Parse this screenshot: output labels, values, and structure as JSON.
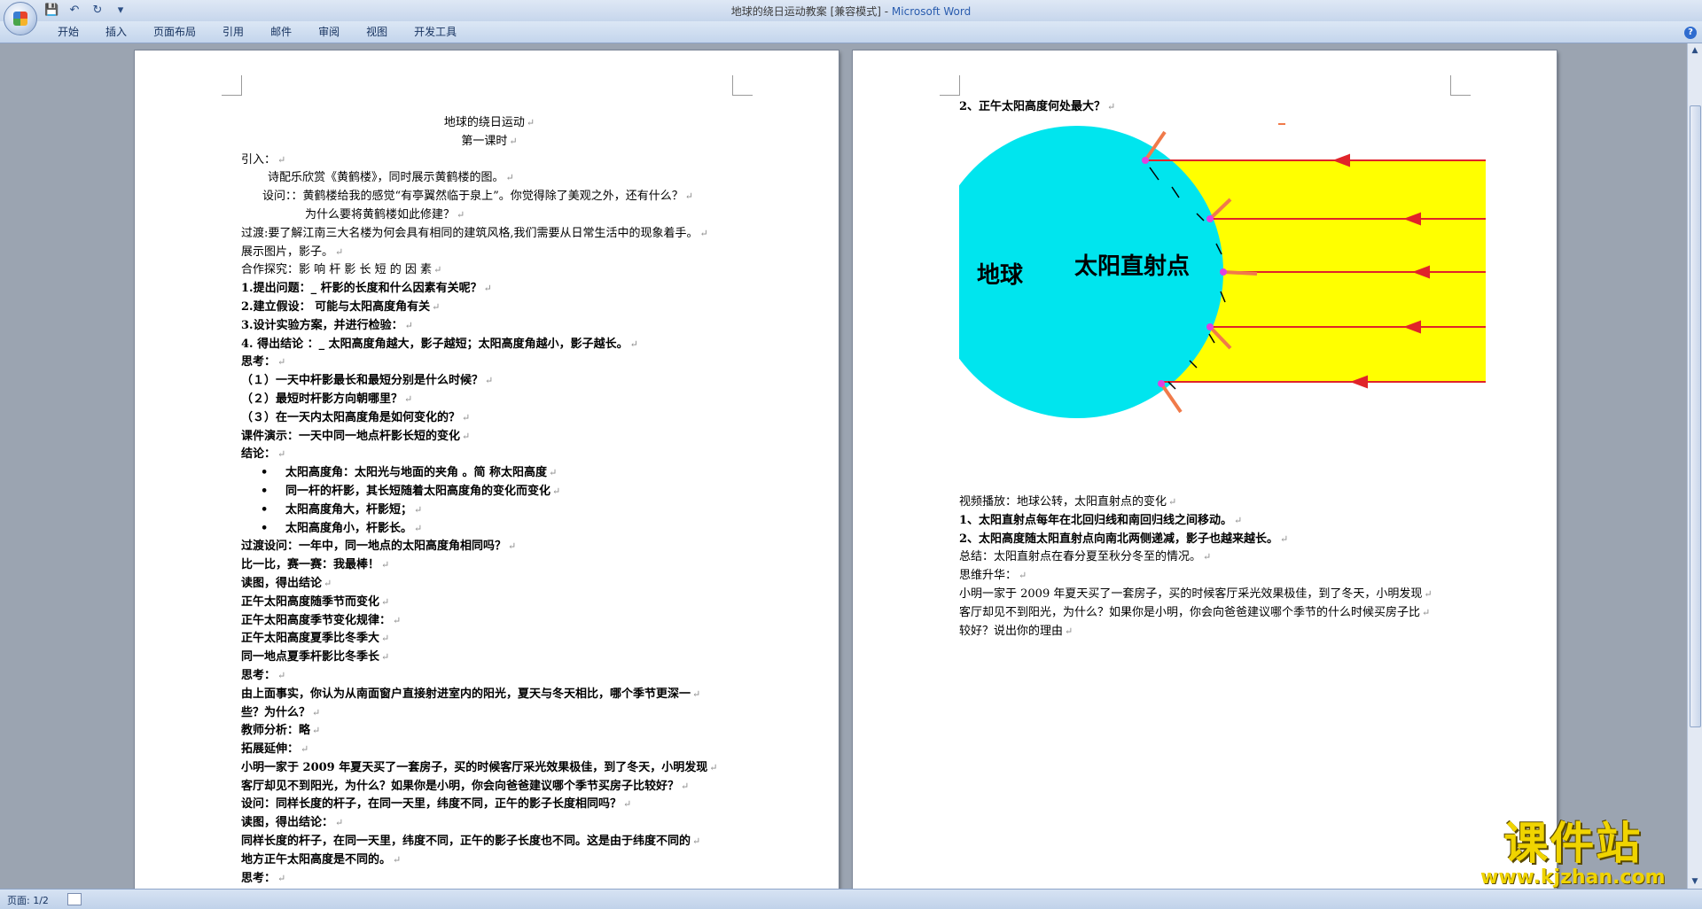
{
  "window": {
    "title": "地球的绕日运动教案 [兼容模式] - ",
    "app_name": "Microsoft Word"
  },
  "menu": {
    "tabs": [
      "开始",
      "插入",
      "页面布局",
      "引用",
      "邮件",
      "审阅",
      "视图",
      "开发工具"
    ]
  },
  "page1": {
    "lines": [
      {
        "t": "地球的绕日运动",
        "s": "center"
      },
      {
        "t": "第一课时",
        "s": "center"
      },
      {
        "t": "引入：",
        "s": ""
      },
      {
        "t": "诗配乐欣赏《黄鹤楼》，同时展示黄鹤楼的图。",
        "s": "ind1"
      },
      {
        "t": "设问：：黄鹤楼给我的感觉“有亭翼然临于泉上”。你觉得除了美观之外，还有什么？",
        "s": "ind2"
      },
      {
        "t": "为什么要将黄鹤楼如此修建？",
        "s": "ind3"
      },
      {
        "t": "过渡:要了解江南三大名楼为何会具有相同的建筑风格,我们需要从日常生活中的现象着手。",
        "s": ""
      },
      {
        "t": "展示图片，影子。",
        "s": ""
      },
      {
        "t": "合作探究：影 响 杆 影 长 短 的 因 素",
        "s": ""
      },
      {
        "t": "1.提出问题：_ 杆影的长度和什么因素有关呢？",
        "s": "b"
      },
      {
        "t": "2.建立假设： 可能与太阳高度角有关",
        "s": "b"
      },
      {
        "t": "3.设计实验方案，并进行检验：",
        "s": "b"
      },
      {
        "t": "4. 得出结论 ：_ 太阳高度角越大，影子越短；太阳高度角越小，影子越长。",
        "s": "b"
      },
      {
        "t": "思考：",
        "s": "b"
      },
      {
        "t": "（１）一天中杆影最长和最短分别是什么时候？",
        "s": "b"
      },
      {
        "t": "（２）最短时杆影方向朝哪里？",
        "s": "b"
      },
      {
        "t": "（３）在一天内太阳高度角是如何变化的？",
        "s": "b"
      },
      {
        "t": "课件演示：一天中同一地点杆影长短的变化",
        "s": "b"
      },
      {
        "t": "结论：",
        "s": "b"
      },
      {
        "t": "太阳高度角：太阳光与地面的夹角 。简 称太阳高度",
        "s": "bullet"
      },
      {
        "t": "同一杆的杆影，其长短随着太阳高度角的变化而变化",
        "s": "bullet"
      },
      {
        "t": "太阳高度角大，杆影短；",
        "s": "bullet"
      },
      {
        "t": "太阳高度角小，杆影长。",
        "s": "bullet"
      },
      {
        "t": "过渡设问：一年中，同一地点的太阳高度角相同吗？",
        "s": "b"
      },
      {
        "t": "比一比，赛一赛：我最棒！",
        "s": "b"
      },
      {
        "t": "读图，得出结论",
        "s": "b"
      },
      {
        "t": "正午太阳高度随季节而变化",
        "s": "b"
      },
      {
        "t": "正午太阳高度季节变化规律：",
        "s": "b"
      },
      {
        "t": "正午太阳高度夏季比冬季大",
        "s": "b"
      },
      {
        "t": "同一地点夏季杆影比冬季长",
        "s": "b"
      },
      {
        "t": "思考：",
        "s": "b"
      },
      {
        "t": "由上面事实，你认为从南面窗户直接射进室内的阳光，夏天与冬天相比，哪个季节更深一",
        "s": "b"
      },
      {
        "t": "些？为什么？",
        "s": "b"
      },
      {
        "t": "教师分析：略",
        "s": "b"
      },
      {
        "t": "拓展延伸：",
        "s": "b"
      },
      {
        "t": "小明一家于 2009 年夏天买了一套房子，买的时候客厅采光效果极佳，到了冬天，小明发现",
        "s": "b"
      },
      {
        "t": "客厅却见不到阳光，为什么？如果你是小明，你会向爸爸建议哪个季节买房子比较好？",
        "s": "b"
      },
      {
        "t": "设问：同样长度的杆子，在同一天里，纬度不同，正午的影子长度相同吗？",
        "s": "b"
      },
      {
        "t": "读图，得出结论：",
        "s": "b"
      },
      {
        "t": "同样长度的杆子，在同一天里，纬度不同，正午的影子长度也不同。这是由于纬度不同的",
        "s": "b"
      },
      {
        "t": "地方正午太阳高度是不同的。",
        "s": "b"
      },
      {
        "t": "思考：",
        "s": "b"
      }
    ]
  },
  "page2": {
    "heading": "2、正午太阳高度何处最大？",
    "diagram": {
      "earth_label": "地球",
      "subsolar_label": "太阳直射点",
      "earth_color": "#00e5ee",
      "sunlight_color": "#ffff00",
      "ray_color": "#e0242a",
      "pole_color": "#f07a4a",
      "point_color": "#e040e0"
    },
    "lines": [
      {
        "t": "视频播放：地球公转，太阳直射点的变化",
        "s": ""
      },
      {
        "t": "1、太阳直射点每年在北回归线和南回归线之间移动。",
        "s": "b"
      },
      {
        "t": "2、太阳高度随太阳直射点向南北两侧递减，影子也越来越长。",
        "s": "b"
      },
      {
        "t": "总结：太阳直射点在春分夏至秋分冬至的情况。",
        "s": ""
      },
      {
        "t": "思维升华：",
        "s": ""
      },
      {
        "t": "小明一家于 2009 年夏天买了一套房子，买的时候客厅采光效果极佳，到了冬天，小明发现",
        "s": ""
      },
      {
        "t": "客厅却见不到阳光，为什么？如果你是小明，你会向爸爸建议哪个季节的什么时候买房子比",
        "s": ""
      },
      {
        "t": "较好？说出你的理由",
        "s": ""
      }
    ]
  },
  "status": {
    "page_indicator": "页面: 1/2"
  },
  "watermark": {
    "title": "课件站",
    "url": "www.kjzhan.com"
  }
}
